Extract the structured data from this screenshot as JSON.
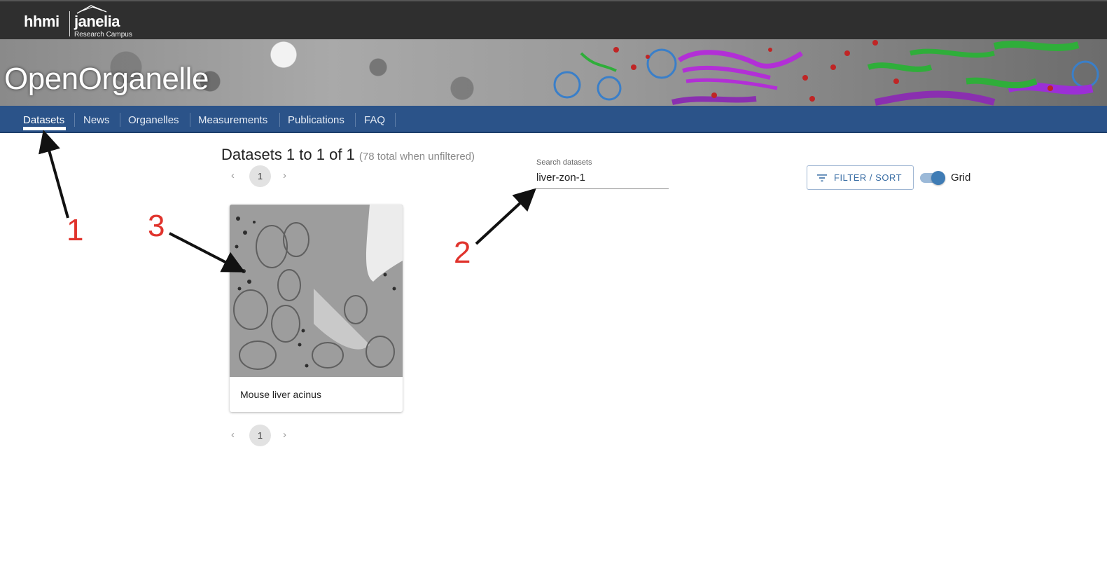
{
  "header": {
    "logo_hhmi": "hhmi",
    "logo_janelia": "janelia",
    "logo_subtitle": "Research Campus",
    "site_title": "OpenOrganelle"
  },
  "nav": {
    "items": [
      {
        "label": "Datasets",
        "active": true
      },
      {
        "label": "News"
      },
      {
        "label": "Organelles"
      },
      {
        "label": "Measurements"
      },
      {
        "label": "Publications"
      },
      {
        "label": "FAQ"
      }
    ]
  },
  "results": {
    "heading": "Datasets 1 to 1 of 1",
    "heading_sub": "(78 total when unfiltered)",
    "current_page": "1",
    "prev_icon": "chevron-left-icon",
    "next_icon": "chevron-right-icon"
  },
  "search": {
    "label": "Search datasets",
    "value": "liver-zon-1"
  },
  "toolbar": {
    "filter_label": "FILTER / SORT",
    "filter_icon": "filter-list-icon",
    "view_toggle_label": "Grid",
    "view_toggle_on": true
  },
  "cards": [
    {
      "title": "Mouse liver acinus"
    }
  ],
  "annotations": {
    "one": "1",
    "two": "2",
    "three": "3",
    "color": "#e0332c"
  },
  "colors": {
    "topbar": "#2f2f2f",
    "navbar": "#2b5389",
    "accent": "#3a6ea5"
  }
}
